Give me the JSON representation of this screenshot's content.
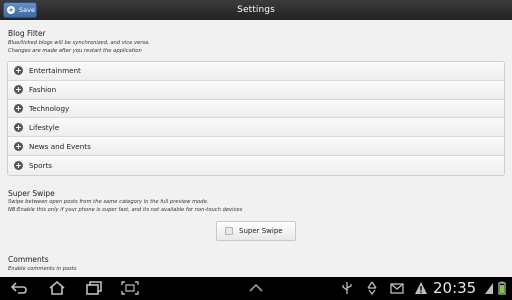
{
  "header": {
    "title": "Settings",
    "save_label": "Save"
  },
  "blog_filter": {
    "title": "Blog Filter",
    "desc_line1": "Blue/ticked blogs will be synchronized, and vice versa.",
    "desc_line2": "Changes are made after you restart the application",
    "items": [
      {
        "label": "Entertainment"
      },
      {
        "label": "Fashion"
      },
      {
        "label": "Technology"
      },
      {
        "label": "Lifestyle"
      },
      {
        "label": "News and Events"
      },
      {
        "label": "Sports"
      }
    ]
  },
  "super_swipe": {
    "title": "Super Swipe",
    "desc_line1": "Swipe between open posts from the same category in the full preview mode.",
    "desc_line2": "NB:Enable this only if your phone is super fast, and its not available for non-touch devices",
    "button_label": "Super Swipe",
    "checked": false
  },
  "comments": {
    "title": "Comments",
    "desc": "Enable comments in posts"
  },
  "system_bar": {
    "time": "20:35",
    "icons": [
      "back-icon",
      "home-icon",
      "recent-apps-icon",
      "screenshot-icon",
      "up-arrow-icon",
      "usb-icon",
      "recycle-icon",
      "mail-icon",
      "warning-icon",
      "wifi-icon",
      "battery-icon"
    ]
  },
  "colors": {
    "save_button": "#3f6aa8",
    "top_bar": "#2a2a2a",
    "background": "#f1f1f1"
  }
}
